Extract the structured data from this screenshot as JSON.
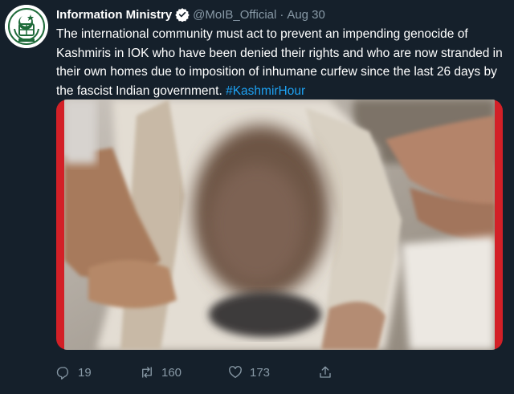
{
  "tweet": {
    "author_name": "Information Ministry",
    "author_handle": "@MoIB_Official",
    "separator": "·",
    "date": "Aug 30",
    "text": "The international community must act to prevent an impending genocide of Kashmiris in IOK who have been denied their rights and who are now stranded in their own homes due to imposition of inhumane curfew since the last 26 days by the fascist Indian government. ",
    "hashtag": "#KashmirHour",
    "media_icon": "blurred-photo"
  },
  "actions": {
    "reply": {
      "icon": "reply-icon",
      "count": "19"
    },
    "retweet": {
      "icon": "retweet-icon",
      "count": "160"
    },
    "like": {
      "icon": "heart-icon",
      "count": "173"
    },
    "share": {
      "icon": "share-icon"
    }
  },
  "colors": {
    "background": "#15202b",
    "secondary_text": "#8899a6",
    "link": "#1da1f2",
    "media_border": "#d32027"
  }
}
